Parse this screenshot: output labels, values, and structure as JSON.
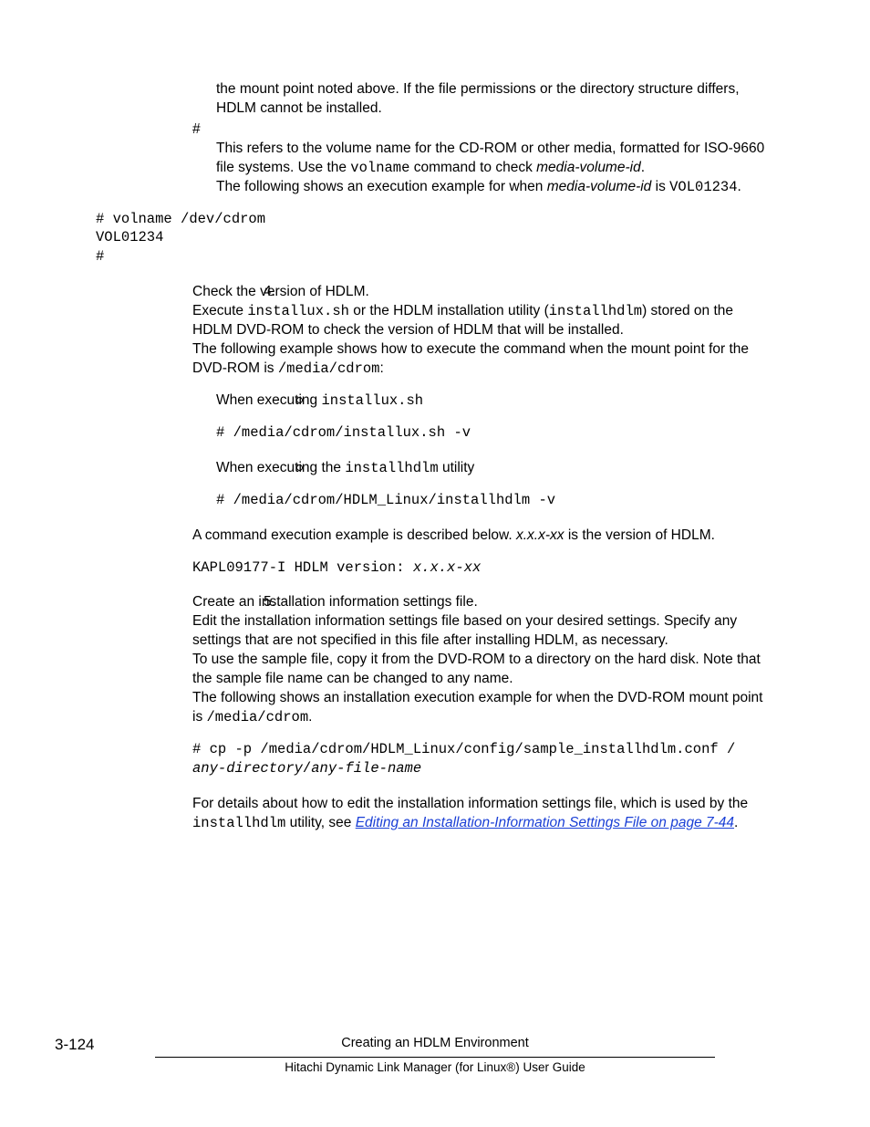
{
  "para1": "the mount point noted above. If the file permissions or the directory structure differs, HDLM cannot be installed.",
  "hash": "#",
  "para2a": "This refers to the volume name for the CD-ROM or other media, formatted for ISO-9660 file systems. Use the ",
  "para2_code": "volname",
  "para2b": " command to check ",
  "para2_it": "media-volume-id",
  "para2c": ".",
  "para3a": "The following shows an execution example for when ",
  "para3_it": "media-volume-id",
  "para3b": " is ",
  "para3_code": "VOL01234",
  "para3c": ".",
  "code1_l1": "# volname /dev/cdrom",
  "code1_l2": "VOL01234",
  "code1_l3": "#",
  "step4_num": "4.",
  "step4_title": "Check the version of HDLM.",
  "step4_p1a": "Execute ",
  "step4_p1_code1": "installux.sh",
  "step4_p1b": " or the HDLM installation utility (",
  "step4_p1_code2": "installhdlm",
  "step4_p1c": ") stored on the HDLM DVD-ROM to check the version of HDLM that will be installed.",
  "step4_p2a": "The following example shows how to execute the command when the mount point for the DVD-ROM is ",
  "step4_p2_code": "/media/cdrom",
  "step4_p2b": ":",
  "sub1_a": "When executing ",
  "sub1_code": "installux.sh",
  "sub1_cmd": "# /media/cdrom/installux.sh -v",
  "sub2_a": "When executing the ",
  "sub2_code": "installhdlm",
  "sub2_b": " utility",
  "sub2_cmd": "# /media/cdrom/HDLM_Linux/installhdlm -v",
  "step4_p3a": "A command execution example is described below. ",
  "step4_p3_it": "x.x.x-xx",
  "step4_p3b": " is the version of HDLM.",
  "step4_code_a": "KAPL09177-I HDLM version: ",
  "step4_code_it": "x.x.x-xx",
  "step5_num": "5.",
  "step5_title": "Create an installation information settings file.",
  "step5_p1": "Edit the installation information settings file based on your desired settings. Specify any settings that are not specified in this file after installing HDLM, as necessary.",
  "step5_p2": "To use the sample file, copy it from the DVD-ROM to a directory on the hard disk. Note that the sample file name can be changed to any name.",
  "step5_p3a": "The following shows an installation execution example for when the DVD-ROM mount point is ",
  "step5_p3_code": "/media/cdrom",
  "step5_p3b": ".",
  "step5_code_l1": "# cp -p /media/cdrom/HDLM_Linux/config/sample_installhdlm.conf /",
  "step5_code_it1": "any-directory",
  "step5_code_sep": "/",
  "step5_code_it2": "any-file-name",
  "step5_p4a": "For details about how to edit the installation information settings file, which is used by the ",
  "step5_p4_code": "installhdlm",
  "step5_p4b": " utility, see ",
  "step5_link": "Editing an Installation-Information Settings File on page 7-44",
  "step5_p4c": ".",
  "page_num": "3-124",
  "footer_top": "Creating an HDLM Environment",
  "footer_bottom": "Hitachi Dynamic Link Manager (for Linux®) User Guide"
}
